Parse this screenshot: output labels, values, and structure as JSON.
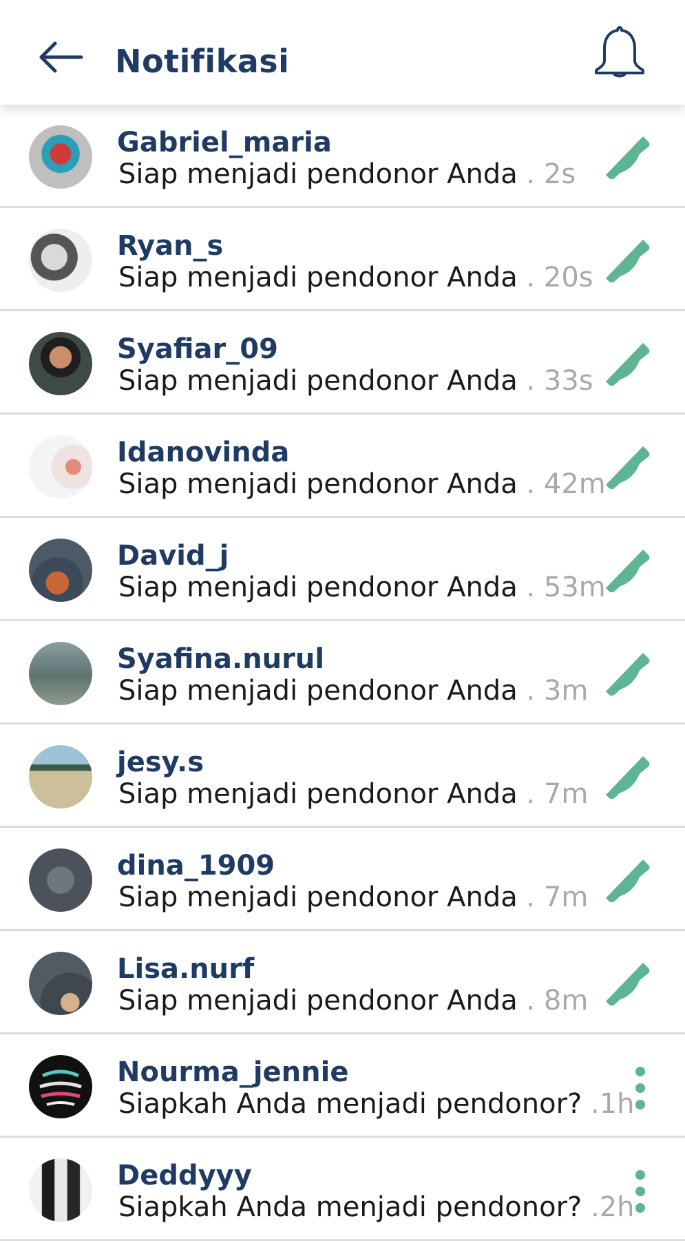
{
  "header": {
    "title": "Notifikasi"
  },
  "colors": {
    "title": "#1f3b63",
    "accent": "#5db594",
    "muted": "#a9a9a9"
  },
  "notifications": [
    {
      "name": "Gabriel_maria",
      "message": "Siap menjadi pendonor Anda",
      "time": " . 2s",
      "action": "phone-icon"
    },
    {
      "name": "Ryan_s",
      "message": "Siap menjadi pendonor Anda",
      "time": " . 20s",
      "action": "phone-icon"
    },
    {
      "name": "Syafiar_09",
      "message": "Siap menjadi pendonor Anda",
      "time": "  . 33s",
      "action": "phone-icon"
    },
    {
      "name": "Idanovinda",
      "message": "Siap menjadi pendonor Anda",
      "time": " . 42m",
      "action": "phone-icon"
    },
    {
      "name": "David_j",
      "message": "Siap menjadi pendonor Anda",
      "time": " . 53m",
      "action": "phone-icon"
    },
    {
      "name": "Syafina.nurul",
      "message": "Siap menjadi pendonor Anda",
      "time": "  . 3m",
      "action": "phone-icon"
    },
    {
      "name": "jesy.s",
      "message": "Siap menjadi pendonor Anda",
      "time": " . 7m",
      "action": "phone-icon"
    },
    {
      "name": "dina_1909",
      "message": "Siap menjadi pendonor Anda",
      "time": " . 7m",
      "action": "phone-icon"
    },
    {
      "name": "Lisa.nurf",
      "message": "Siap menjadi pendonor Anda",
      "time": "  . 8m",
      "action": "phone-icon"
    },
    {
      "name": "Nourma_jennie",
      "message": "Siapkah Anda menjadi pendonor?",
      "time": " .1h",
      "action": "more-vertical-icon"
    },
    {
      "name": "Deddyyy",
      "message": "Siapkah Anda menjadi pendonor?",
      "time": " .2h",
      "action": "more-vertical-icon"
    }
  ]
}
